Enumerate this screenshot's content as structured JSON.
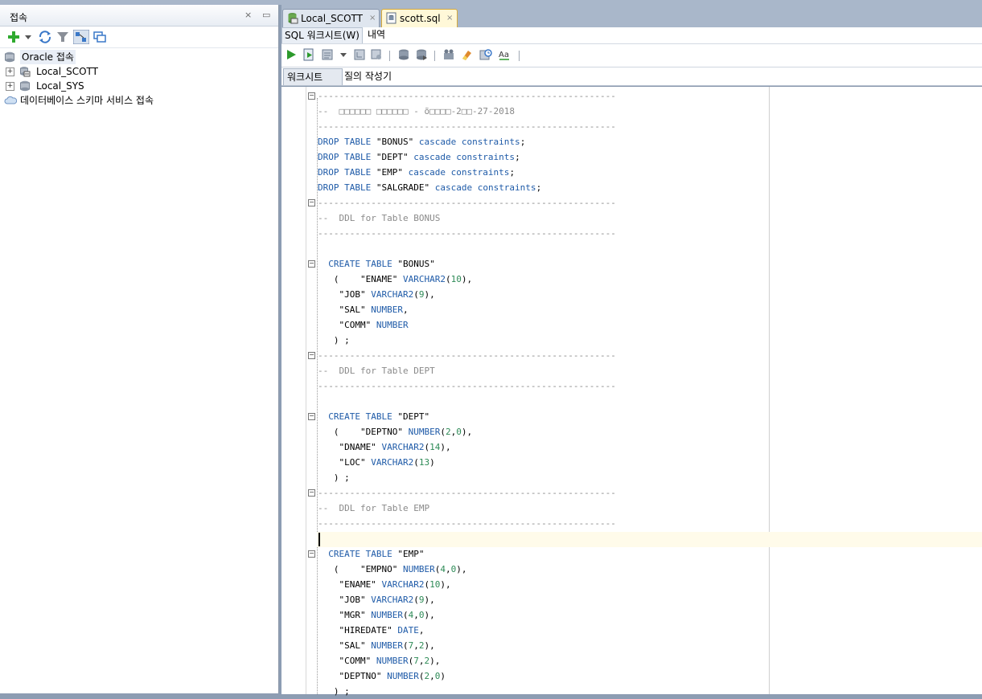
{
  "connections_panel": {
    "title": "접속",
    "close_symbol": "×",
    "minimize_symbol": "▭",
    "tree": [
      {
        "label": "Oracle 접속",
        "level": 0,
        "icon": "database-icon"
      },
      {
        "label": "Local_SCOTT",
        "level": 1,
        "icon": "connection-icon",
        "expander": "+"
      },
      {
        "label": "Local_SYS",
        "level": 1,
        "icon": "database-icon",
        "expander": "+"
      },
      {
        "label": "데이터베이스 스키마 서비스 접속",
        "level": 0,
        "icon": "cloud-icon"
      }
    ]
  },
  "editor_tabs": [
    {
      "label": "Local_SCOTT",
      "close": "×",
      "active": false
    },
    {
      "label": "scott.sql",
      "close": "×",
      "active": true
    }
  ],
  "sub_tabs": [
    {
      "label": "SQL 워크시트(W)"
    },
    {
      "label": "내역"
    }
  ],
  "worksheet_tabs": [
    {
      "label": "워크시트"
    },
    {
      "label": "질의 작성기"
    }
  ],
  "colors": {
    "keyword": "#1f5ba8",
    "comment": "#8a8a8a",
    "number": "#2e8b57",
    "current_line": "#fffbea"
  },
  "code_lines": [
    {
      "segments": [
        {
          "t": "--------------------------------------------------------",
          "c": "cm"
        }
      ]
    },
    {
      "segments": [
        {
          "t": "--  □□□□□□ □□□□□□ - õ□□□□-2□□-27-2018",
          "c": "cm"
        }
      ]
    },
    {
      "segments": [
        {
          "t": "--------------------------------------------------------",
          "c": "cm"
        }
      ]
    },
    {
      "segments": [
        {
          "t": "DROP TABLE",
          "c": "kw"
        },
        {
          "t": " \"BONUS\" ",
          "c": ""
        },
        {
          "t": "cascade constraints",
          "c": "kw"
        },
        {
          "t": ";",
          "c": ""
        }
      ]
    },
    {
      "segments": [
        {
          "t": "DROP TABLE",
          "c": "kw"
        },
        {
          "t": " \"DEPT\" ",
          "c": ""
        },
        {
          "t": "cascade constraints",
          "c": "kw"
        },
        {
          "t": ";",
          "c": ""
        }
      ]
    },
    {
      "segments": [
        {
          "t": "DROP TABLE",
          "c": "kw"
        },
        {
          "t": " \"EMP\" ",
          "c": ""
        },
        {
          "t": "cascade constraints",
          "c": "kw"
        },
        {
          "t": ";",
          "c": ""
        }
      ]
    },
    {
      "segments": [
        {
          "t": "DROP TABLE",
          "c": "kw"
        },
        {
          "t": " \"SALGRADE\" ",
          "c": ""
        },
        {
          "t": "cascade constraints",
          "c": "kw"
        },
        {
          "t": ";",
          "c": ""
        }
      ]
    },
    {
      "segments": [
        {
          "t": "--------------------------------------------------------",
          "c": "cm"
        }
      ]
    },
    {
      "segments": [
        {
          "t": "--  DDL for Table BONUS",
          "c": "cm"
        }
      ]
    },
    {
      "segments": [
        {
          "t": "--------------------------------------------------------",
          "c": "cm"
        }
      ]
    },
    {
      "segments": [
        {
          "t": "",
          "c": ""
        }
      ]
    },
    {
      "segments": [
        {
          "t": "  ",
          "c": ""
        },
        {
          "t": "CREATE TABLE",
          "c": "kw"
        },
        {
          "t": " \"BONUS\"",
          "c": ""
        }
      ]
    },
    {
      "segments": [
        {
          "t": "   (    \"ENAME\" ",
          "c": ""
        },
        {
          "t": "VARCHAR2",
          "c": "kw"
        },
        {
          "t": "(",
          "c": ""
        },
        {
          "t": "10",
          "c": "num"
        },
        {
          "t": "),",
          "c": ""
        }
      ]
    },
    {
      "segments": [
        {
          "t": "    \"JOB\" ",
          "c": ""
        },
        {
          "t": "VARCHAR2",
          "c": "kw"
        },
        {
          "t": "(",
          "c": ""
        },
        {
          "t": "9",
          "c": "num"
        },
        {
          "t": "),",
          "c": ""
        }
      ]
    },
    {
      "segments": [
        {
          "t": "    \"SAL\" ",
          "c": ""
        },
        {
          "t": "NUMBER",
          "c": "kw"
        },
        {
          "t": ",",
          "c": ""
        }
      ]
    },
    {
      "segments": [
        {
          "t": "    \"COMM\" ",
          "c": ""
        },
        {
          "t": "NUMBER",
          "c": "kw"
        }
      ]
    },
    {
      "segments": [
        {
          "t": "   ) ;",
          "c": ""
        }
      ]
    },
    {
      "segments": [
        {
          "t": "--------------------------------------------------------",
          "c": "cm"
        }
      ]
    },
    {
      "segments": [
        {
          "t": "--  DDL for Table DEPT",
          "c": "cm"
        }
      ]
    },
    {
      "segments": [
        {
          "t": "--------------------------------------------------------",
          "c": "cm"
        }
      ]
    },
    {
      "segments": [
        {
          "t": "",
          "c": ""
        }
      ]
    },
    {
      "segments": [
        {
          "t": "  ",
          "c": ""
        },
        {
          "t": "CREATE TABLE",
          "c": "kw"
        },
        {
          "t": " \"DEPT\"",
          "c": ""
        }
      ]
    },
    {
      "segments": [
        {
          "t": "   (    \"DEPTNO\" ",
          "c": ""
        },
        {
          "t": "NUMBER",
          "c": "kw"
        },
        {
          "t": "(",
          "c": ""
        },
        {
          "t": "2",
          "c": "num"
        },
        {
          "t": ",",
          "c": ""
        },
        {
          "t": "0",
          "c": "num"
        },
        {
          "t": "),",
          "c": ""
        }
      ]
    },
    {
      "segments": [
        {
          "t": "    \"DNAME\" ",
          "c": ""
        },
        {
          "t": "VARCHAR2",
          "c": "kw"
        },
        {
          "t": "(",
          "c": ""
        },
        {
          "t": "14",
          "c": "num"
        },
        {
          "t": "),",
          "c": ""
        }
      ]
    },
    {
      "segments": [
        {
          "t": "    \"LOC\" ",
          "c": ""
        },
        {
          "t": "VARCHAR2",
          "c": "kw"
        },
        {
          "t": "(",
          "c": ""
        },
        {
          "t": "13",
          "c": "num"
        },
        {
          "t": ")",
          "c": ""
        }
      ]
    },
    {
      "segments": [
        {
          "t": "   ) ;",
          "c": ""
        }
      ]
    },
    {
      "segments": [
        {
          "t": "--------------------------------------------------------",
          "c": "cm"
        }
      ]
    },
    {
      "segments": [
        {
          "t": "--  DDL for Table EMP",
          "c": "cm"
        }
      ]
    },
    {
      "segments": [
        {
          "t": "--------------------------------------------------------",
          "c": "cm"
        }
      ]
    },
    {
      "segments": [
        {
          "t": "",
          "c": ""
        }
      ]
    },
    {
      "segments": [
        {
          "t": "  ",
          "c": ""
        },
        {
          "t": "CREATE TABLE",
          "c": "kw"
        },
        {
          "t": " \"EMP\"",
          "c": ""
        }
      ]
    },
    {
      "segments": [
        {
          "t": "   (    \"EMPNO\" ",
          "c": ""
        },
        {
          "t": "NUMBER",
          "c": "kw"
        },
        {
          "t": "(",
          "c": ""
        },
        {
          "t": "4",
          "c": "num"
        },
        {
          "t": ",",
          "c": ""
        },
        {
          "t": "0",
          "c": "num"
        },
        {
          "t": "),",
          "c": ""
        }
      ]
    },
    {
      "segments": [
        {
          "t": "    \"ENAME\" ",
          "c": ""
        },
        {
          "t": "VARCHAR2",
          "c": "kw"
        },
        {
          "t": "(",
          "c": ""
        },
        {
          "t": "10",
          "c": "num"
        },
        {
          "t": "),",
          "c": ""
        }
      ]
    },
    {
      "segments": [
        {
          "t": "    \"JOB\" ",
          "c": ""
        },
        {
          "t": "VARCHAR2",
          "c": "kw"
        },
        {
          "t": "(",
          "c": ""
        },
        {
          "t": "9",
          "c": "num"
        },
        {
          "t": "),",
          "c": ""
        }
      ]
    },
    {
      "segments": [
        {
          "t": "    \"MGR\" ",
          "c": ""
        },
        {
          "t": "NUMBER",
          "c": "kw"
        },
        {
          "t": "(",
          "c": ""
        },
        {
          "t": "4",
          "c": "num"
        },
        {
          "t": ",",
          "c": ""
        },
        {
          "t": "0",
          "c": "num"
        },
        {
          "t": "),",
          "c": ""
        }
      ]
    },
    {
      "segments": [
        {
          "t": "    \"HIREDATE\" ",
          "c": ""
        },
        {
          "t": "DATE",
          "c": "kw"
        },
        {
          "t": ",",
          "c": ""
        }
      ]
    },
    {
      "segments": [
        {
          "t": "    \"SAL\" ",
          "c": ""
        },
        {
          "t": "NUMBER",
          "c": "kw"
        },
        {
          "t": "(",
          "c": ""
        },
        {
          "t": "7",
          "c": "num"
        },
        {
          "t": ",",
          "c": ""
        },
        {
          "t": "2",
          "c": "num"
        },
        {
          "t": "),",
          "c": ""
        }
      ]
    },
    {
      "segments": [
        {
          "t": "    \"COMM\" ",
          "c": ""
        },
        {
          "t": "NUMBER",
          "c": "kw"
        },
        {
          "t": "(",
          "c": ""
        },
        {
          "t": "7",
          "c": "num"
        },
        {
          "t": ",",
          "c": ""
        },
        {
          "t": "2",
          "c": "num"
        },
        {
          "t": "),",
          "c": ""
        }
      ]
    },
    {
      "segments": [
        {
          "t": "    \"DEPTNO\" ",
          "c": ""
        },
        {
          "t": "NUMBER",
          "c": "kw"
        },
        {
          "t": "(",
          "c": ""
        },
        {
          "t": "2",
          "c": "num"
        },
        {
          "t": ",",
          "c": ""
        },
        {
          "t": "0",
          "c": "num"
        },
        {
          "t": ")",
          "c": ""
        }
      ]
    },
    {
      "segments": [
        {
          "t": "   ) ;",
          "c": ""
        }
      ]
    }
  ]
}
